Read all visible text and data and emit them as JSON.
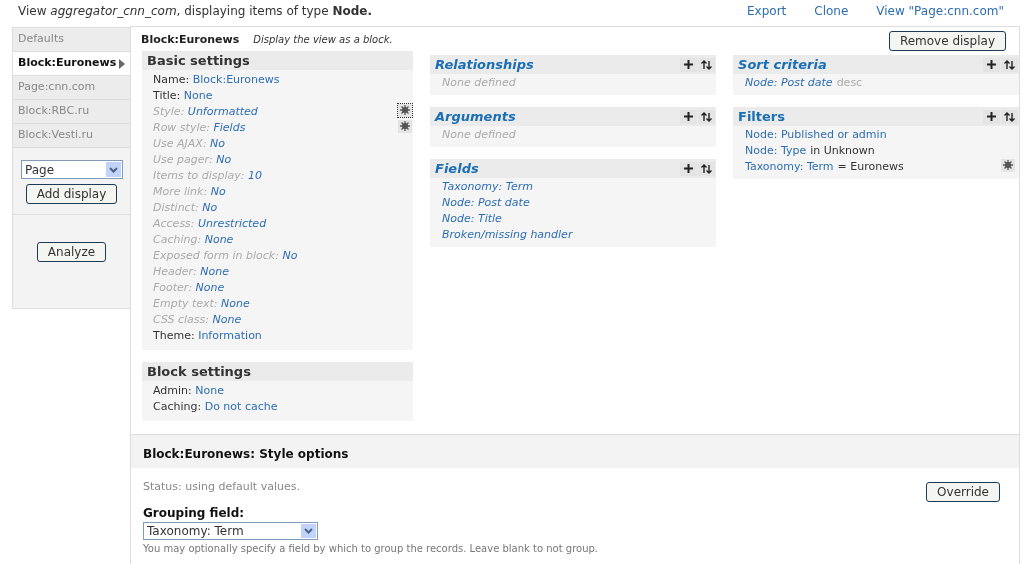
{
  "header": {
    "prefix": "View ",
    "view_name": "aggregator_cnn_com",
    "middle": ", displaying items of type ",
    "type": "Node.",
    "links": [
      "Export",
      "Clone",
      "View \"Page:cnn.com\""
    ]
  },
  "sidebar": {
    "tabs": [
      {
        "label": "Defaults",
        "selected": false
      },
      {
        "label": "Block:Euronews",
        "selected": true
      },
      {
        "label": "Page:cnn.com",
        "selected": false
      },
      {
        "label": "Block:RBC.ru",
        "selected": false
      },
      {
        "label": "Block:Vesti.ru",
        "selected": false
      }
    ],
    "display_type": "Page",
    "add_button": "Add display",
    "analyze_button": "Analyze"
  },
  "display": {
    "title": "Block:Euronews",
    "description": "Display the view as a block.",
    "remove_button": "Remove display"
  },
  "basic_settings": {
    "title": "Basic settings",
    "rows": [
      {
        "label": "Name:",
        "value": "Block:Euronews",
        "defaulted": false,
        "settings": false
      },
      {
        "label": "Title:",
        "value": "None",
        "defaulted": false,
        "settings": false
      },
      {
        "label": "Style:",
        "value": "Unformatted",
        "defaulted": true,
        "settings": true
      },
      {
        "label": "Row style:",
        "value": "Fields",
        "defaulted": true,
        "settings": true
      },
      {
        "label": "Use AJAX:",
        "value": "No",
        "defaulted": true,
        "settings": false
      },
      {
        "label": "Use pager:",
        "value": "No",
        "defaulted": true,
        "settings": false
      },
      {
        "label": "Items to display:",
        "value": "10",
        "defaulted": true,
        "settings": false
      },
      {
        "label": "More link:",
        "value": "No",
        "defaulted": true,
        "settings": false
      },
      {
        "label": "Distinct:",
        "value": "No",
        "defaulted": true,
        "settings": false
      },
      {
        "label": "Access:",
        "value": "Unrestricted",
        "defaulted": true,
        "settings": false
      },
      {
        "label": "Caching:",
        "value": "None",
        "defaulted": true,
        "settings": false
      },
      {
        "label": "Exposed form in block:",
        "value": "No",
        "defaulted": true,
        "settings": false
      },
      {
        "label": "Header:",
        "value": "None",
        "defaulted": true,
        "settings": false
      },
      {
        "label": "Footer:",
        "value": "None",
        "defaulted": true,
        "settings": false
      },
      {
        "label": "Empty text:",
        "value": "None",
        "defaulted": true,
        "settings": false
      },
      {
        "label": "CSS class:",
        "value": "None",
        "defaulted": true,
        "settings": false
      },
      {
        "label": "Theme:",
        "value": "Information",
        "defaulted": false,
        "settings": false
      }
    ]
  },
  "block_settings": {
    "title": "Block settings",
    "rows": [
      {
        "label": "Admin:",
        "value": "None",
        "defaulted": false,
        "settings": false
      },
      {
        "label": "Caching:",
        "value": "Do not cache",
        "defaulted": false,
        "settings": false
      }
    ]
  },
  "columns": [
    [
      {
        "title": "Relationships",
        "defaulted": true,
        "settings": false,
        "empty": "None defined"
      },
      {
        "title": "Arguments",
        "defaulted": true,
        "settings": false,
        "empty": "None defined"
      },
      {
        "title": "Fields",
        "defaulted": true,
        "settings": false,
        "items": [
          {
            "link": "Taxonomy: Term"
          },
          {
            "link": "Node: Post date"
          },
          {
            "link": "Node: Title"
          },
          {
            "link": "Broken/missing handler"
          }
        ]
      }
    ],
    [
      {
        "title": "Sort criteria",
        "defaulted": true,
        "settings": false,
        "items": [
          {
            "link": "Node: Post date",
            "suffix": "desc"
          }
        ]
      },
      {
        "title": "Filters",
        "defaulted": false,
        "settings": true,
        "items": [
          {
            "link": "Node: Published or admin"
          },
          {
            "link": "Node: Type",
            "suffix": "in Unknown"
          },
          {
            "link": "Taxonomy: Term",
            "suffix": "= Euronews"
          }
        ]
      }
    ]
  ],
  "style_options": {
    "title": "Block:Euronews: Style options",
    "status": "Status: using default values.",
    "override_button": "Override",
    "grouping_label": "Grouping field:",
    "grouping_value": "Taxonomy: Term",
    "description": "You may optionally specify a field by which to group the records. Leave blank to not group."
  }
}
